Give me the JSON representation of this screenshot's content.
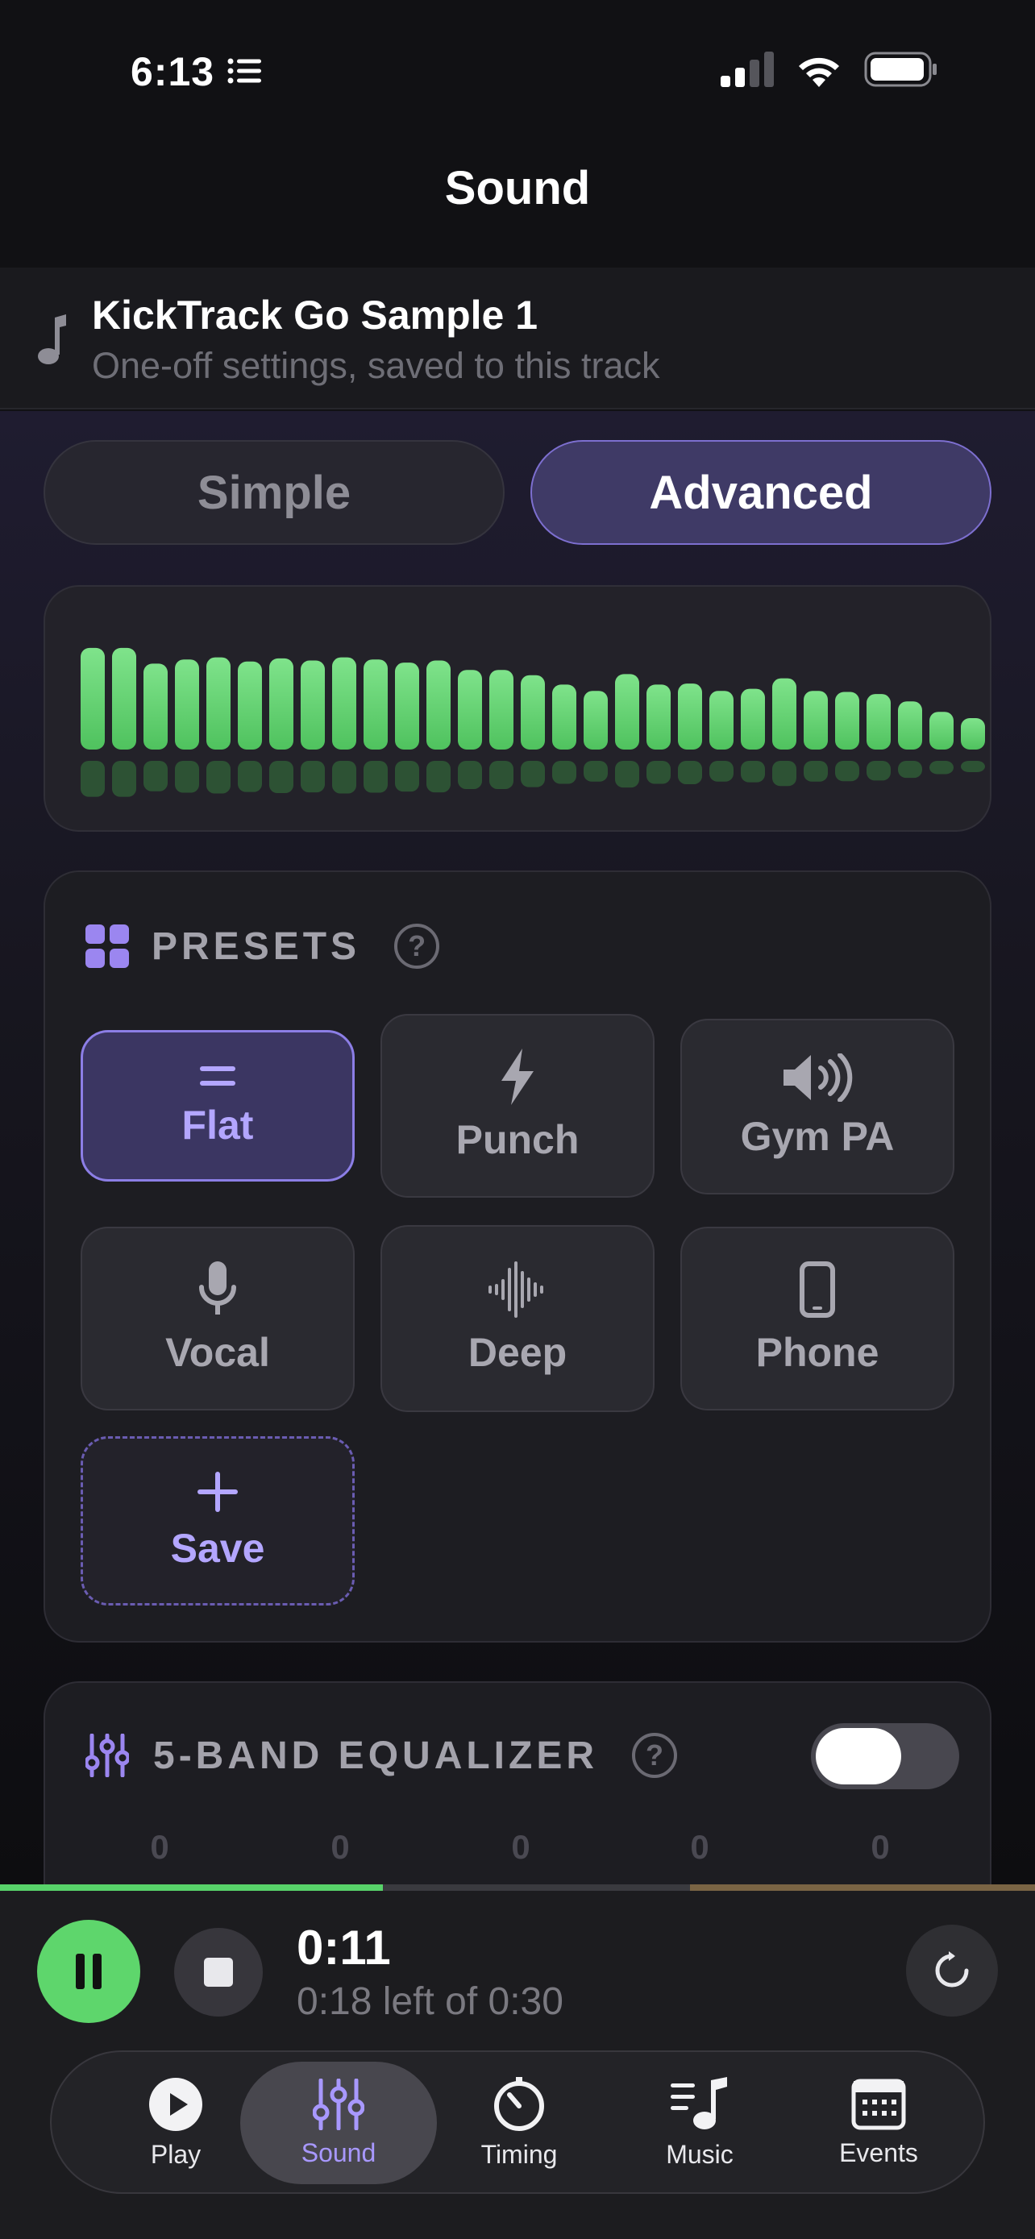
{
  "status_bar": {
    "time": "6:13"
  },
  "nav": {
    "title": "Sound"
  },
  "track": {
    "title": "KickTrack Go Sample 1",
    "subtitle": "One-off settings, saved to this track"
  },
  "mode": {
    "simple": "Simple",
    "advanced": "Advanced",
    "selected": "Advanced"
  },
  "visualizer": {
    "levels": [
      0.97,
      0.97,
      0.82,
      0.86,
      0.88,
      0.84,
      0.87,
      0.85,
      0.88,
      0.86,
      0.83,
      0.85,
      0.76,
      0.76,
      0.71,
      0.62,
      0.56,
      0.72,
      0.62,
      0.63,
      0.56,
      0.58,
      0.68,
      0.56,
      0.55,
      0.53,
      0.46,
      0.36,
      0.3
    ],
    "bar_color": "#5fd36d"
  },
  "presets": {
    "heading": "PRESETS",
    "items": [
      {
        "label": "Flat",
        "icon": "equals-icon",
        "active": true
      },
      {
        "label": "Punch",
        "icon": "bolt-icon",
        "active": false
      },
      {
        "label": "Gym PA",
        "icon": "speaker-icon",
        "active": false
      },
      {
        "label": "Vocal",
        "icon": "microphone-icon",
        "active": false
      },
      {
        "label": "Deep",
        "icon": "waveform-icon",
        "active": false
      },
      {
        "label": "Phone",
        "icon": "phone-icon",
        "active": false
      }
    ],
    "save_label": "Save"
  },
  "equalizer": {
    "heading": "5-BAND EQUALIZER",
    "enabled": false,
    "bands": [
      "0",
      "0",
      "0",
      "0",
      "0"
    ]
  },
  "player": {
    "elapsed": "0:11",
    "remaining": "0:18 left of 0:30",
    "progress": 0.37,
    "accent": "#5ed66c"
  },
  "tabs": [
    {
      "label": "Play",
      "icon": "play-icon"
    },
    {
      "label": "Sound",
      "icon": "sliders-icon",
      "active": true
    },
    {
      "label": "Timing",
      "icon": "timer-icon"
    },
    {
      "label": "Music",
      "icon": "music-icon"
    },
    {
      "label": "Events",
      "icon": "calendar-icon"
    }
  ],
  "colors": {
    "accent": "#8c7ee6",
    "green": "#5ed66c"
  }
}
